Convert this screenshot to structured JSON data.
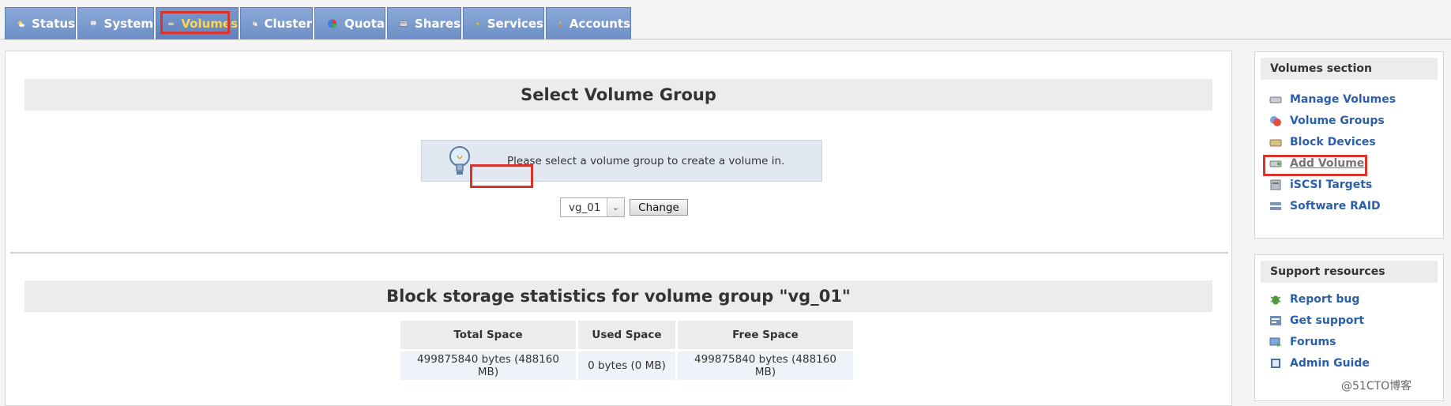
{
  "tabs": [
    {
      "label": "Status",
      "icon": "weather-icon"
    },
    {
      "label": "System",
      "icon": "computer-icon"
    },
    {
      "label": "Volumes",
      "icon": "drive-icon",
      "active": true
    },
    {
      "label": "Cluster",
      "icon": "cluster-icon"
    },
    {
      "label": "Quota",
      "icon": "pie-icon"
    },
    {
      "label": "Shares",
      "icon": "share-icon"
    },
    {
      "label": "Services",
      "icon": "lightning-icon"
    },
    {
      "label": "Accounts",
      "icon": "accounts-icon"
    }
  ],
  "main": {
    "select_title": "Select Volume Group",
    "notice": "Please select a volume group to create a volume in.",
    "select_value": "vg_01",
    "change_label": "Change",
    "stats_title": "Block storage statistics for volume group \"vg_01\"",
    "stats_headers": [
      "Total Space",
      "Used Space",
      "Free Space"
    ],
    "stats_values": [
      "499875840 bytes (488160 MB)",
      "0 bytes (0 MB)",
      "499875840 bytes (488160 MB)"
    ]
  },
  "sidebar": {
    "volumes_title": "Volumes section",
    "volumes_items": [
      {
        "label": "Manage Volumes",
        "icon": "drive-icon"
      },
      {
        "label": "Volume Groups",
        "icon": "volume-group-icon"
      },
      {
        "label": "Block Devices",
        "icon": "block-device-icon"
      },
      {
        "label": "Add Volume",
        "icon": "add-volume-icon",
        "current": true
      },
      {
        "label": "iSCSI Targets",
        "icon": "iscsi-icon"
      },
      {
        "label": "Software RAID",
        "icon": "raid-icon"
      }
    ],
    "support_title": "Support resources",
    "support_items": [
      {
        "label": "Report bug",
        "icon": "bug-icon"
      },
      {
        "label": "Get support",
        "icon": "support-icon"
      },
      {
        "label": "Forums",
        "icon": "forum-icon"
      },
      {
        "label": "Admin Guide",
        "icon": "book-icon"
      }
    ]
  },
  "watermark": "@51CTO博客",
  "colors": {
    "accent": "#6d8fc6",
    "link": "#2b5fa8",
    "highlight": "#d9332b"
  }
}
